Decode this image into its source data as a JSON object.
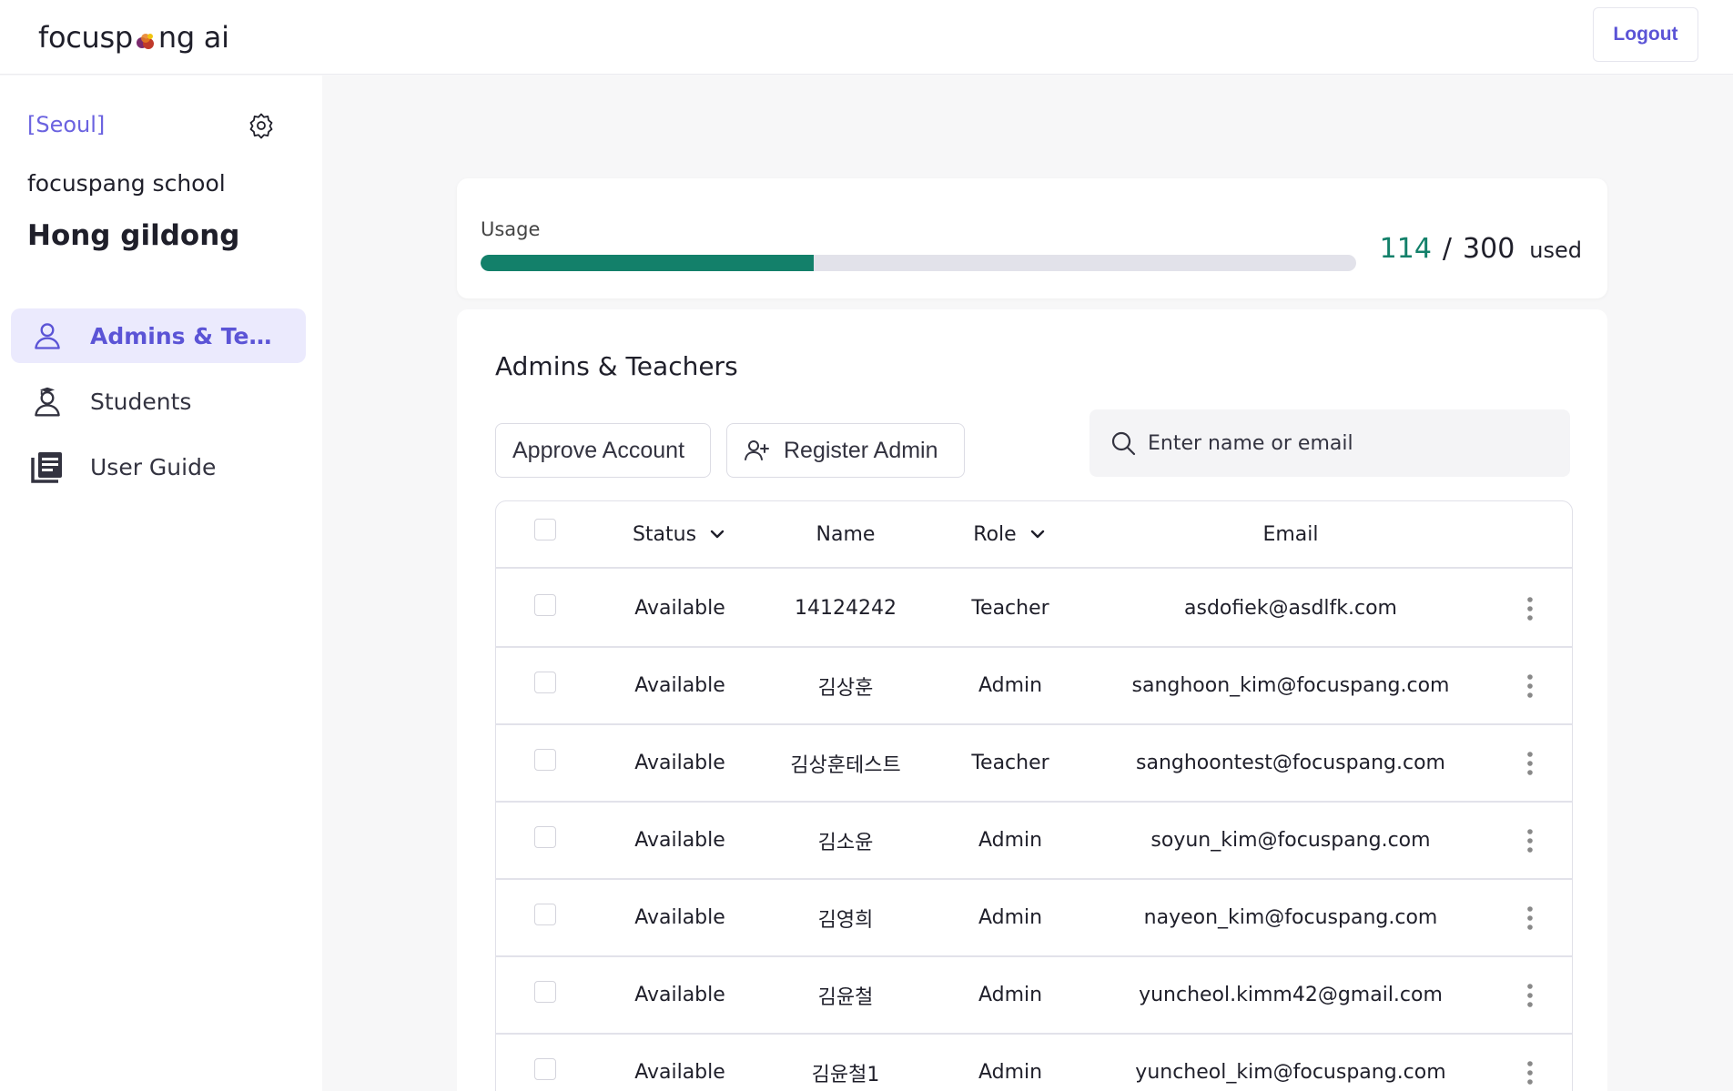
{
  "header": {
    "logo_prefix": "focusp",
    "logo_suffix": "ng ai",
    "logout_label": "Logout"
  },
  "sidebar": {
    "region": "[Seoul]",
    "school": "focuspang school",
    "user": "Hong gildong",
    "items": [
      {
        "label": "Admins & Teachers",
        "icon": "person-icon",
        "active": true
      },
      {
        "label": "Students",
        "icon": "graduate-icon",
        "active": false
      },
      {
        "label": "User Guide",
        "icon": "book-icon",
        "active": false
      }
    ]
  },
  "usage": {
    "title": "Usage",
    "used": "114",
    "slash": "/",
    "total": "300",
    "suffix": "used",
    "fraction": 0.38
  },
  "main": {
    "title": "Admins & Teachers",
    "approve_label": "Approve Account",
    "register_label": "Register Admin",
    "search_placeholder": "Enter name or email",
    "columns": {
      "status": "Status",
      "name": "Name",
      "role": "Role",
      "email": "Email"
    },
    "rows": [
      {
        "status": "Available",
        "name": "14124242",
        "role": "Teacher",
        "email": "asdofiek@asdlfk.com"
      },
      {
        "status": "Available",
        "name": "김상훈",
        "role": "Admin",
        "email": "sanghoon_kim@focuspang.com"
      },
      {
        "status": "Available",
        "name": "김상훈테스트",
        "role": "Teacher",
        "email": "sanghoontest@focuspang.com"
      },
      {
        "status": "Available",
        "name": "김소윤",
        "role": "Admin",
        "email": "soyun_kim@focuspang.com"
      },
      {
        "status": "Available",
        "name": "김영희",
        "role": "Admin",
        "email": "nayeon_kim@focuspang.com"
      },
      {
        "status": "Available",
        "name": "김윤철",
        "role": "Admin",
        "email": "yuncheol.kimm42@gmail.com"
      },
      {
        "status": "Available",
        "name": "김윤철1",
        "role": "Admin",
        "email": "yuncheol_kim@focuspang.com"
      }
    ]
  },
  "colors": {
    "accent": "#5b54d6",
    "usage_fill": "#13806a",
    "active_nav_bg": "#ebeafd"
  }
}
